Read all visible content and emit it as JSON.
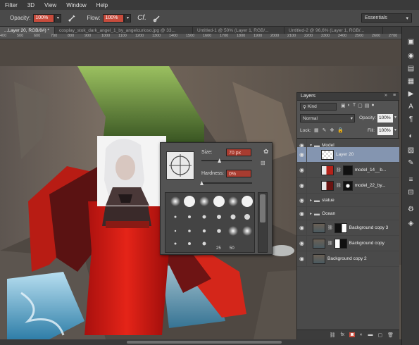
{
  "menubar": {
    "items": [
      "Filter",
      "3D",
      "View",
      "Window",
      "Help"
    ]
  },
  "options": {
    "opacity_label": "Opacity:",
    "opacity_value": "100%",
    "flow_label": "Flow:",
    "flow_value": "100%",
    "workspace": "Essentials"
  },
  "tabs": [
    "...Layer 20, RGB/8#) *",
    "cosplay_stok_dark_angel_1_by_angelcurioso.jpg @ 33...",
    "Untitled-1 @ 50% (Layer 1, RGB/...",
    "Untitled-2 @ 96,6% (Layer 1, RGB/..."
  ],
  "ruler": [
    "400",
    "500",
    "600",
    "700",
    "800",
    "900",
    "1000",
    "1100",
    "1200",
    "1300",
    "1400",
    "1500",
    "1600",
    "1700",
    "1800",
    "1900",
    "2000",
    "2100",
    "2200",
    "2300",
    "2400",
    "2500",
    "2600",
    "2700"
  ],
  "brush": {
    "size_label": "Size:",
    "size_value": "70 px",
    "size_fraction": 0.35,
    "hardness_label": "Hardness:",
    "hardness_value": "0%",
    "hardness_fraction": 0.0,
    "preset_numbers": [
      "25",
      "50"
    ]
  },
  "layers": {
    "title": "Layers",
    "kind": "Kind",
    "blend_mode": "Normal",
    "opacity_label": "Opacity:",
    "opacity_value": "100%",
    "lock_label": "Lock:",
    "fill_label": "Fill:",
    "fill_value": "100%",
    "rows": {
      "model": "Model",
      "layer20": "Layer 20",
      "model14": "model_14__b...",
      "model22": "model_22_by...",
      "statue": "statue",
      "ocean": "Ocean",
      "bgcopy3": "Background copy 3",
      "bgcopy": "Background copy",
      "bgcopy2": "Background copy 2"
    },
    "footer_icons": [
      "link-icon",
      "fx-icon",
      "mask-icon",
      "adjustment-icon",
      "group-icon",
      "new-layer-icon",
      "trash-icon"
    ]
  },
  "colors": {
    "accent_red": "#c84b3c",
    "selection": "#8495b0",
    "panel": "#535353"
  }
}
